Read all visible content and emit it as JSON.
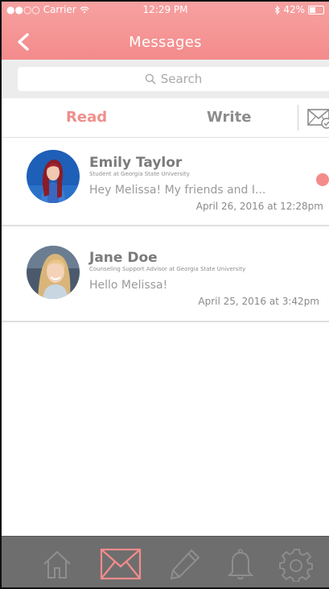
{
  "status_bar": {
    "carrier": "●●○○ Carrier",
    "time": "12:29 PM",
    "battery": "42%"
  },
  "header": {
    "title": "Messages"
  },
  "search": {
    "placeholder": "Search"
  },
  "tabs": {
    "read": "Read",
    "write": "Write"
  },
  "messages": [
    {
      "name": "Emily Taylor",
      "subtitle": "Student at Georgia State University",
      "preview": "Hey Melissa! My friends and I...",
      "date": "April 26, 2016 at 12:28pm",
      "unread": true
    },
    {
      "name": "Jane Doe",
      "subtitle": "Counseling Support Advisor at Georgia State University",
      "preview": "Hello Melissa!",
      "date": "April 25, 2016 at 3:42pm",
      "unread": false
    }
  ],
  "bottom_tabs": {
    "items": [
      "home-icon",
      "mail-icon",
      "pencil-icon",
      "bell-icon",
      "gear-icon"
    ],
    "active": "mail-icon"
  },
  "colors": {
    "accent": "#f48b8b",
    "tab_bar": "#6e6e6e"
  }
}
